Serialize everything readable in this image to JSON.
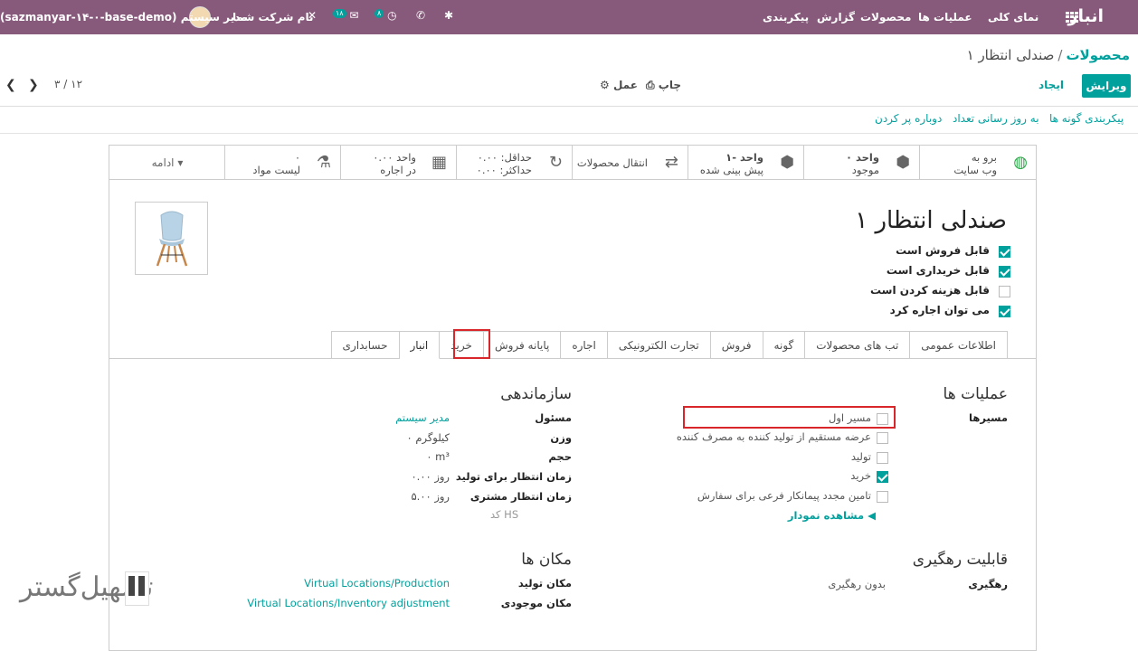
{
  "topbar": {
    "app_name": "انبار",
    "menu": [
      "نمای کلی",
      "عملیات ها",
      "محصولات",
      "گزارش",
      "پیکربندی"
    ],
    "company": "نام شرکت شما",
    "user": "مدیر سیستم",
    "db": "(sazmanyar-۱۴-۰-base-demo)",
    "activity_count": "۸",
    "messages_count": "۱۸"
  },
  "breadcrumb": {
    "root": "محصولات",
    "sep": "/",
    "current": "صندلی انتظار ۱"
  },
  "control": {
    "edit": "ویرایش",
    "create": "ایجاد",
    "print": "چاپ",
    "action": "عمل",
    "pager": "۳ / ۱۲"
  },
  "header_buttons": [
    "پیکربندی گونه ها",
    "به روز رسانی تعداد",
    "دوباره پر کردن"
  ],
  "smart_buttons": [
    {
      "line1": "برو به",
      "line2": "وب سایت",
      "icon": "globe-icon"
    },
    {
      "line1": "۰ واحد",
      "line2": "موجود",
      "icon": "cubes-icon"
    },
    {
      "line1": "۱- واحد",
      "line2": "پیش بینی شده",
      "icon": "cubes-icon"
    },
    {
      "line1": "انتقال محصولات",
      "line2": "",
      "icon": "exchange-icon"
    },
    {
      "line1": "حداقل:   ۰.۰۰",
      "line2": "حداکثر:   ۰.۰۰",
      "icon": "refresh-icon"
    },
    {
      "line1": "۰.۰۰ واحد",
      "line2": "در اجاره",
      "icon": "calendar-icon"
    },
    {
      "line1": "۰",
      "line2": "لیست مواد",
      "icon": "flask-icon"
    }
  ],
  "more_label": "ادامه",
  "product": {
    "name": "صندلی انتظار ۱",
    "flags": [
      {
        "label": "قابل فروش است",
        "checked": true
      },
      {
        "label": "قابل خریداری است",
        "checked": true
      },
      {
        "label": "قابل هزینه کردن است",
        "checked": false
      },
      {
        "label": "می توان اجاره کرد",
        "checked": true
      }
    ]
  },
  "tabs": [
    "اطلاعات عمومی",
    "تب های محصولات",
    "گونه",
    "فروش",
    "تجارت الکترونیکی",
    "اجاره",
    "پایانه فروش",
    "خرید",
    "انبار",
    "حسابداری"
  ],
  "active_tab": "انبار",
  "operations": {
    "title": "عملیات ها",
    "routes_label": "مسیرها",
    "routes": [
      {
        "label": "مسیر اول",
        "checked": false
      },
      {
        "label": "عرضه مستقیم از تولید کننده به مصرف کننده",
        "checked": false
      },
      {
        "label": "تولید",
        "checked": false
      },
      {
        "label": "خرید",
        "checked": true
      },
      {
        "label": "تامین مجدد پیمانکار فرعی برای سفارش",
        "checked": false
      }
    ],
    "diagram_link": "مشاهده نمودار"
  },
  "organization": {
    "title": "سازماندهی",
    "rows": [
      {
        "label": "مسئول",
        "value": "مدیر سیستم"
      },
      {
        "label": "وزن",
        "value": "۰ کیلوگرم"
      },
      {
        "label": "حجم",
        "value": "۰ m³"
      },
      {
        "label": "زمان انتظار برای تولید",
        "value": "۰.۰۰ روز"
      },
      {
        "label": "زمان انتظار مشتری",
        "value": "۵.۰۰ روز"
      },
      {
        "label": "",
        "value": "کد HS"
      }
    ]
  },
  "tracking": {
    "title": "قابلیت رهگیری",
    "label": "رهگیری",
    "value": "بدون رهگیری"
  },
  "locations": {
    "title": "مکان ها",
    "rows": [
      {
        "label": "مکان تولید",
        "value": "Virtual Locations/Production"
      },
      {
        "label": "مکان موجودی",
        "value": "Virtual Locations/Inventory adjustment"
      }
    ]
  },
  "watermark": "تسهیل‌گستر",
  "colors": {
    "brand": "#875a7b",
    "accent": "#00a09d",
    "highlight": "#d9262b"
  }
}
